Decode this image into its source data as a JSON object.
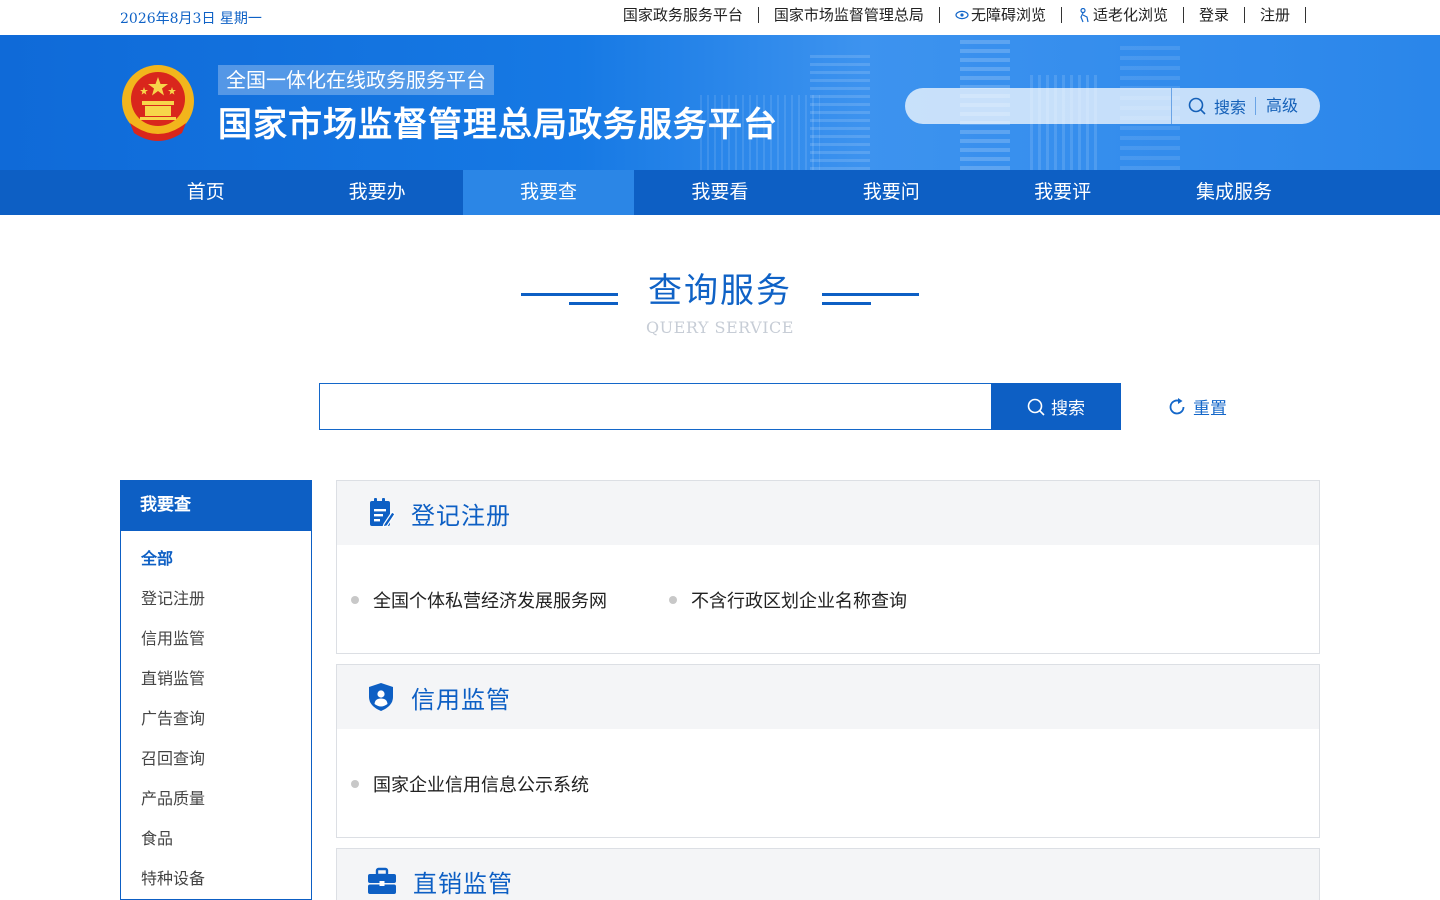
{
  "topbar": {
    "date": "2026年8月3日 星期一",
    "links": [
      "国家政务服务平台",
      "国家市场监督管理总局",
      "无障碍浏览",
      "适老化浏览",
      "登录",
      "注册"
    ]
  },
  "header": {
    "subtitle": "全国一体化在线政务服务平台",
    "title": "国家市场监督管理总局政务服务平台",
    "search_placeholder": "",
    "search_label": "搜索",
    "advanced_label": "高级"
  },
  "nav": {
    "items": [
      "首页",
      "我要办",
      "我要查",
      "我要看",
      "我要问",
      "我要评",
      "集成服务"
    ],
    "active": "我要查"
  },
  "section": {
    "title": "查询服务",
    "subtitle": "QUERY SERVICE"
  },
  "search": {
    "placeholder": "",
    "button_label": "搜索",
    "reset_label": "重置"
  },
  "sidebar": {
    "title": "我要查",
    "items": [
      "全部",
      "登记注册",
      "信用监管",
      "直销监管",
      "广告查询",
      "召回查询",
      "产品质量",
      "食品",
      "特种设备"
    ],
    "active": "全部"
  },
  "categories": [
    {
      "title": "登记注册",
      "icon": "registration-icon",
      "items": [
        "全国个体私营经济发展服务网",
        "不含行政区划企业名称查询"
      ]
    },
    {
      "title": "信用监管",
      "icon": "credit-shield-icon",
      "items": [
        "国家企业信用信息公示系统"
      ]
    },
    {
      "title": "直销监管",
      "icon": "briefcase-icon",
      "items": []
    }
  ],
  "colors": {
    "primary": "#0d5fc4",
    "nav_active": "#2b86e6",
    "banner": "#1679e4",
    "card_header_bg": "#f4f5f7"
  }
}
